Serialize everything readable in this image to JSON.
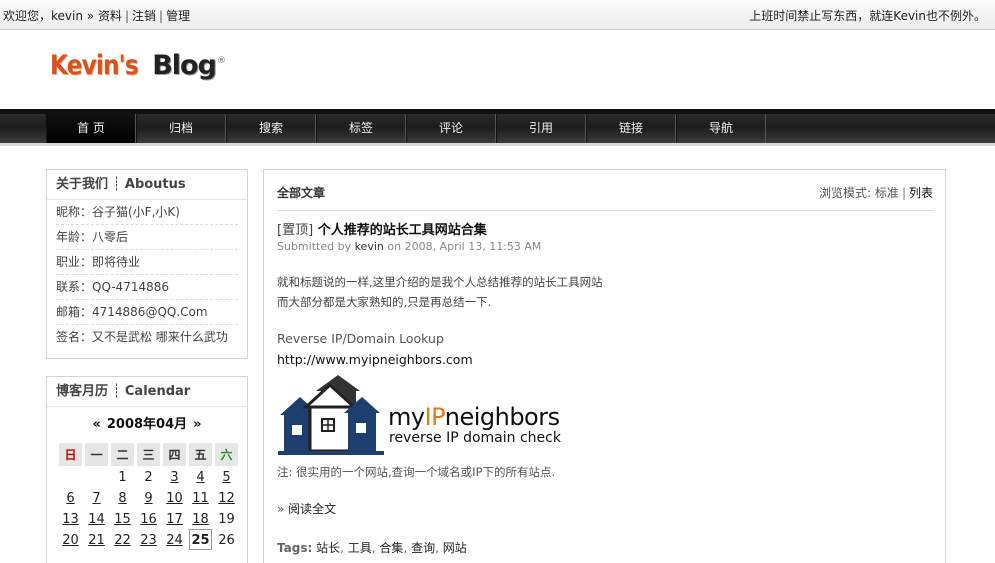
{
  "topbar": {
    "welcome": "欢迎您，kevin »",
    "links": [
      "资料",
      "注销",
      "管理"
    ],
    "motto": "上班时间禁止写东西，就连Kevin也不例外。"
  },
  "logo": {
    "part1": "Kevin's",
    "part2": "Blog",
    "mark": "®"
  },
  "nav": [
    "首 页",
    "归档",
    "搜索",
    "标签",
    "评论",
    "引用",
    "链接",
    "导航"
  ],
  "about": {
    "title": "关于我们 ┊ Aboutus",
    "items": [
      "昵称：谷子猫(小F,小K)",
      "年龄：八零后",
      "职业：即将待业",
      "联系：QQ-4714886",
      "邮箱：4714886@QQ.Com",
      "签名：又不是武松 哪来什么武功"
    ]
  },
  "calendar": {
    "title": "博客月历 ┊ Calendar",
    "prev": "«",
    "month": "2008年04月",
    "next": "»",
    "weekdays": [
      "日",
      "一",
      "二",
      "三",
      "四",
      "五",
      "六"
    ],
    "rows": [
      [
        "",
        "",
        "1",
        "2",
        "3",
        "4",
        "5"
      ],
      [
        "6",
        "7",
        "8",
        "9",
        "10",
        "11",
        "12"
      ],
      [
        "13",
        "14",
        "15",
        "16",
        "17",
        "18",
        "19"
      ],
      [
        "20",
        "21",
        "22",
        "23",
        "24",
        "25",
        "26"
      ]
    ],
    "linked_days": [
      "3",
      "4",
      "5",
      "6",
      "7",
      "8",
      "9",
      "10",
      "11",
      "12",
      "13",
      "14",
      "15",
      "16",
      "17",
      "18",
      "20",
      "21",
      "22",
      "23",
      "24"
    ],
    "today": "25"
  },
  "main": {
    "heading": "全部文章",
    "mode_label": "浏览模式:",
    "mode_standard": "标准",
    "mode_list": "列表"
  },
  "post": {
    "sticky": "[置顶]",
    "title": "个人推荐的站长工具网站合集",
    "submitted_by": "Submitted by",
    "author": "kevin",
    "date": "on 2008, April 13, 11:53 AM",
    "line1": "就和标题说的一样,这里介绍的是我个人总结推荐的站长工具网站",
    "line2": "而大部分都是大家熟知的,只是再总结一下.",
    "ref_label": "Reverse IP/Domain Lookup",
    "ref_url": "http://www.myipneighbors.com",
    "banner_my": "my",
    "banner_ip": "IP",
    "banner_neighbors": "neighbors",
    "banner_sub": "reverse IP domain check",
    "note": "注: 很实用的一个网站,查询一个域名或IP下的所有站点.",
    "readmore_arrow": "»",
    "readmore": "阅读全文",
    "tags_label": "Tags:",
    "tags": [
      "站长",
      "工具",
      "合集",
      "查询",
      "网站"
    ]
  }
}
